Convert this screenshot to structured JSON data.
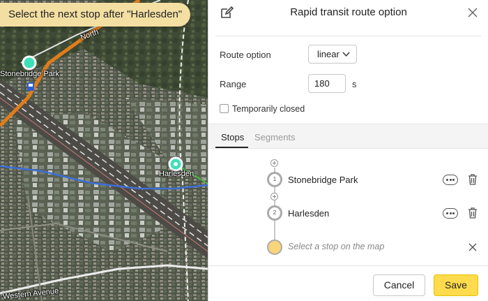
{
  "map": {
    "hint": "Select the next stop after \"Harlesden\"",
    "labels": {
      "stonebridge": "Stonebridge Park",
      "harlesden": "Harlesden",
      "north": "North",
      "western_ave": "Western Avenue"
    }
  },
  "panel": {
    "title": "Rapid transit route option",
    "route_option": {
      "label": "Route option",
      "value": "linear"
    },
    "range": {
      "label": "Range",
      "value": "180",
      "unit": "s"
    },
    "temporarily_closed": {
      "label": "Temporarily closed",
      "checked": false
    },
    "tabs": [
      {
        "label": "Stops",
        "active": true
      },
      {
        "label": "Segments",
        "active": false
      }
    ],
    "stops": [
      {
        "number": "1",
        "name": "Stonebridge Park"
      },
      {
        "number": "2",
        "name": "Harlesden"
      }
    ],
    "pending_stop": "Select a stop on the map",
    "buttons": {
      "cancel": "Cancel",
      "save": "Save"
    }
  },
  "colors": {
    "accent": "#ffdb4d",
    "hint_bg": "#f3dfa2",
    "stop_marker": "#3ee0b8",
    "link_line": "#3cd43c"
  }
}
